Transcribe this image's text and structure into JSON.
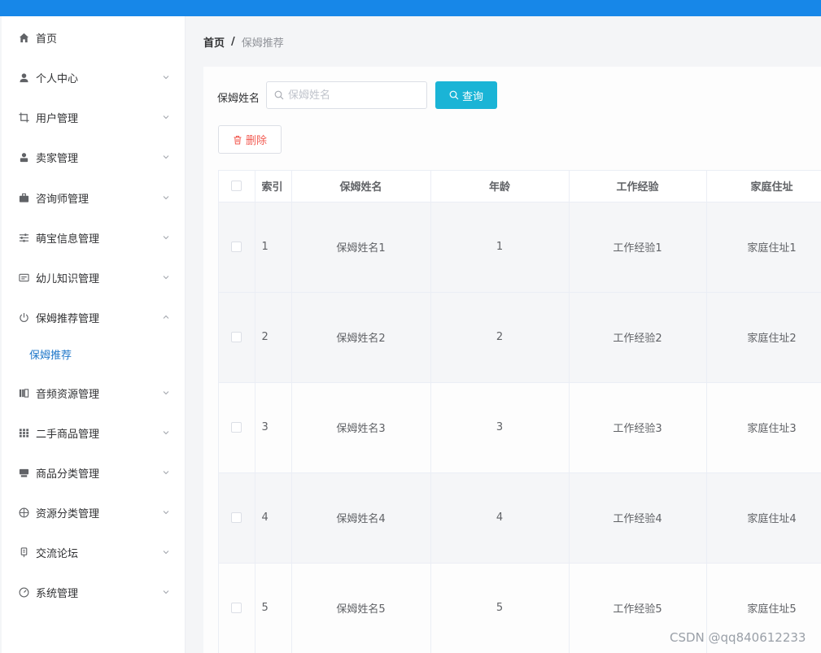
{
  "sidebar": {
    "items": [
      {
        "label": "首页",
        "icon": "home-icon"
      },
      {
        "label": "个人中心",
        "icon": "user-icon"
      },
      {
        "label": "用户管理",
        "icon": "crop-icon"
      },
      {
        "label": "卖家管理",
        "icon": "seller-icon"
      },
      {
        "label": "咨询师管理",
        "icon": "briefcase-icon"
      },
      {
        "label": "萌宝信息管理",
        "icon": "sliders-icon"
      },
      {
        "label": "幼儿知识管理",
        "icon": "card-icon"
      },
      {
        "label": "保姆推荐管理",
        "icon": "power-icon"
      },
      {
        "label": "音频资源管理",
        "icon": "audio-icon"
      },
      {
        "label": "二手商品管理",
        "icon": "grid-icon"
      },
      {
        "label": "商品分类管理",
        "icon": "category-icon"
      },
      {
        "label": "资源分类管理",
        "icon": "globe-icon"
      },
      {
        "label": "交流论坛",
        "icon": "forum-icon"
      },
      {
        "label": "系统管理",
        "icon": "gauge-icon"
      }
    ],
    "subitem": {
      "label": "保姆推荐"
    }
  },
  "breadcrumb": {
    "home": "首页",
    "separator": "/",
    "current": "保姆推荐"
  },
  "search": {
    "label": "保姆姓名",
    "placeholder": "保姆姓名",
    "value": ""
  },
  "buttons": {
    "query": "查询",
    "delete": "删除"
  },
  "table": {
    "headers": [
      "索引",
      "保姆姓名",
      "年龄",
      "工作经验",
      "家庭住址"
    ],
    "rows": [
      {
        "index": "1",
        "name": "保姆姓名1",
        "age": "1",
        "experience": "工作经验1",
        "address": "家庭住址1"
      },
      {
        "index": "2",
        "name": "保姆姓名2",
        "age": "2",
        "experience": "工作经验2",
        "address": "家庭住址2"
      },
      {
        "index": "3",
        "name": "保姆姓名3",
        "age": "3",
        "experience": "工作经验3",
        "address": "家庭住址3"
      },
      {
        "index": "4",
        "name": "保姆姓名4",
        "age": "4",
        "experience": "工作经验4",
        "address": "家庭住址4"
      },
      {
        "index": "5",
        "name": "保姆姓名5",
        "age": "5",
        "experience": "工作经验5",
        "address": "家庭住址5"
      }
    ]
  },
  "watermark": "CSDN @qq840612233",
  "colors": {
    "topbar": "#1787e8",
    "primary_button": "#1ab4d6",
    "danger_text": "#f25b52",
    "active_submenu": "#1f77c9"
  }
}
